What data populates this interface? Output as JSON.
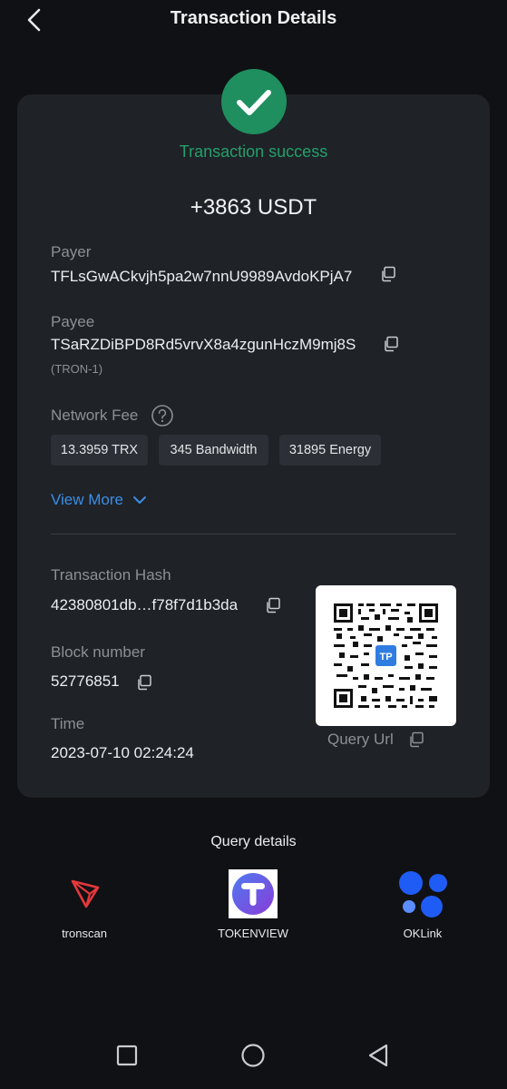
{
  "header": {
    "title": "Transaction Details"
  },
  "status": {
    "text": "Transaction success",
    "color": "#22a06b"
  },
  "amount": "+3863 USDT",
  "payer": {
    "label": "Payer",
    "address": "TFLsGwACkvjh5pa2w7nnU9989AvdoKPjA7"
  },
  "payee": {
    "label": "Payee",
    "address": "TSaRZDiBPD8Rd5vrvX8a4zgunHczM9mj8S",
    "network": "(TRON-1)"
  },
  "fee": {
    "label": "Network Fee",
    "chips": [
      "13.3959 TRX",
      "345 Bandwidth",
      "31895 Energy"
    ]
  },
  "view_more": "View More",
  "hash": {
    "label": "Transaction Hash",
    "value": "42380801db…f78f7d1b3da"
  },
  "block": {
    "label": "Block number",
    "value": "52776851"
  },
  "time": {
    "label": "Time",
    "value": "2023-07-10 02:24:24"
  },
  "qr": {
    "label": "Query Url",
    "badge": "TP"
  },
  "query": {
    "title": "Query details",
    "explorers": [
      {
        "name": "tronscan",
        "icon": "tronscan-logo-icon"
      },
      {
        "name": "TOKENVIEW",
        "icon": "tokenview-logo-icon"
      },
      {
        "name": "OKLink",
        "icon": "oklink-logo-icon"
      }
    ]
  },
  "colors": {
    "accent": "#3a8ee6",
    "success": "#1f8f5f",
    "card": "#1f2227",
    "background": "#101114"
  }
}
